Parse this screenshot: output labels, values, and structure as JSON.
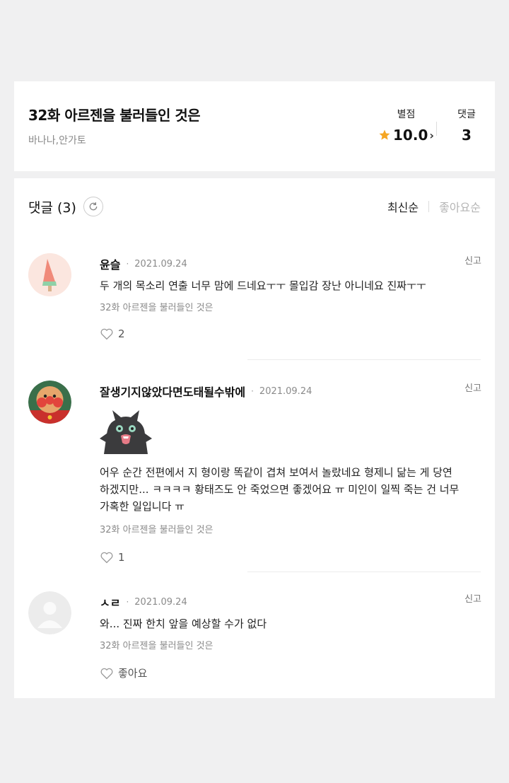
{
  "episode": {
    "title": "32화 아르젠을 불러들인 것은",
    "authors": "바나나,안가토",
    "rating_label": "별점",
    "rating_value": "10.0",
    "comments_label": "댓글",
    "comments_value": "3"
  },
  "comments_section": {
    "heading": "댓글 (3)",
    "sort": {
      "latest": "최신순",
      "likes": "좋아요순"
    }
  },
  "colors": {
    "star": "#f5a623",
    "accent_text": "#111111",
    "muted": "#8a8a8a"
  },
  "comments": [
    {
      "name": "윤슬",
      "date": "2021.09.24",
      "report": "신고",
      "text": "두 개의 목소리 연출 너무 맘에 드네요ㅜㅜ 몰입감 장난 아니네요 진짜ㅜㅜ",
      "episode": "32화 아르젠을 불러들인 것은",
      "likes": "2",
      "avatar_icon": "popsicle-avatar"
    },
    {
      "name": "잘생기지않았다면도태될수밖에",
      "date": "2021.09.24",
      "report": "신고",
      "sticker_icon": "black-cat-sticker",
      "text_lines": [
        "어우 순간 전편에서 지 형이랑 똑같이 겹쳐 보여서 놀랐네요 형제니 닮는 게 당연",
        "하겠지만... ㅋㅋㅋㅋ 황태즈도 안 죽었으면 좋겠어요 ㅠ 미인이 일찍 죽는 건 너무",
        "가혹한 일입니다 ㅠ"
      ],
      "episode": "32화 아르젠을 불러들인 것은",
      "likes": "1",
      "avatar_icon": "anpanman-avatar"
    },
    {
      "name": "ㅅㄹ",
      "date": "2021.09.24",
      "report": "신고",
      "text": "와... 진짜 한치 앞을 예상할 수가 없다",
      "episode": "32화 아르젠을 불러들인 것은",
      "likes": "좋아요",
      "avatar_icon": "default-user-avatar"
    }
  ]
}
